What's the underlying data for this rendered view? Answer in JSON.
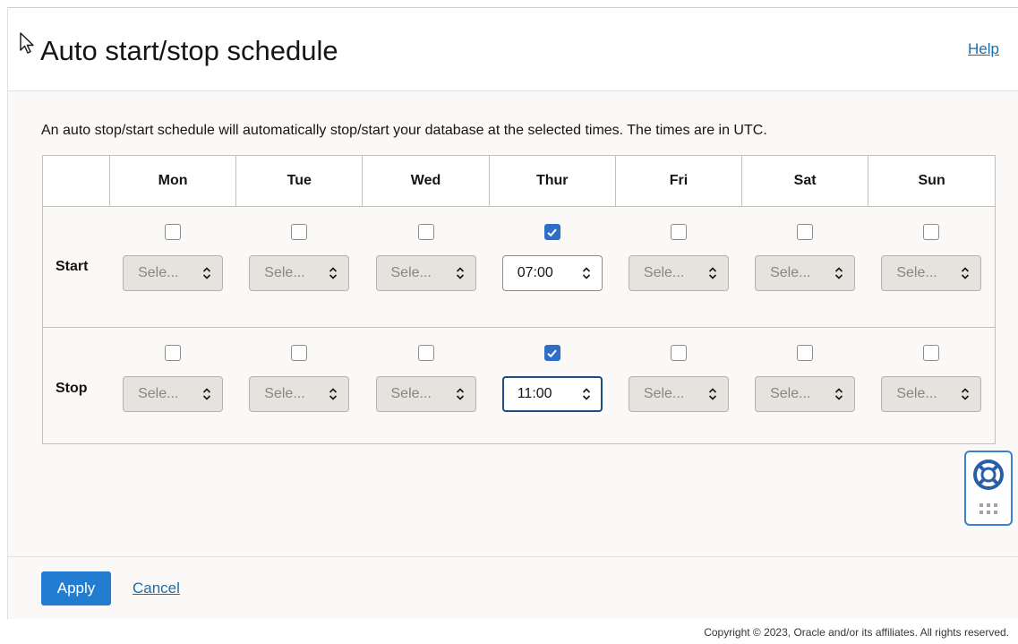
{
  "header": {
    "title": "Auto start/stop schedule",
    "help_label": "Help"
  },
  "description": "An auto stop/start schedule will automatically stop/start your database at the selected times. The times are in UTC.",
  "schedule": {
    "days": [
      "Mon",
      "Tue",
      "Wed",
      "Thur",
      "Fri",
      "Sat",
      "Sun"
    ],
    "rows": [
      {
        "label": "Start",
        "cells": [
          {
            "checked": false,
            "value": "Sele..."
          },
          {
            "checked": false,
            "value": "Sele..."
          },
          {
            "checked": false,
            "value": "Sele..."
          },
          {
            "checked": true,
            "value": "07:00"
          },
          {
            "checked": false,
            "value": "Sele..."
          },
          {
            "checked": false,
            "value": "Sele..."
          },
          {
            "checked": false,
            "value": "Sele..."
          }
        ]
      },
      {
        "label": "Stop",
        "cells": [
          {
            "checked": false,
            "value": "Sele..."
          },
          {
            "checked": false,
            "value": "Sele..."
          },
          {
            "checked": false,
            "value": "Sele..."
          },
          {
            "checked": true,
            "value": "11:00",
            "focused": true
          },
          {
            "checked": false,
            "value": "Sele..."
          },
          {
            "checked": false,
            "value": "Sele..."
          },
          {
            "checked": false,
            "value": "Sele..."
          }
        ]
      }
    ]
  },
  "footer": {
    "apply_label": "Apply",
    "cancel_label": "Cancel"
  },
  "copyright": "Copyright © 2023, Oracle and/or its affiliates. All rights reserved.",
  "colors": {
    "primary": "#227dd0",
    "link": "#1a6ea8",
    "checkbox_checked": "#2f6ec7",
    "focus_border": "#1d4c82"
  },
  "icons": {
    "cursor": "pointer-cursor-icon",
    "help_widget": "lifebuoy-icon",
    "help_widget_grip": "grip-icon",
    "check": "check-icon",
    "select_arrows": "updown-chevron-icon"
  }
}
